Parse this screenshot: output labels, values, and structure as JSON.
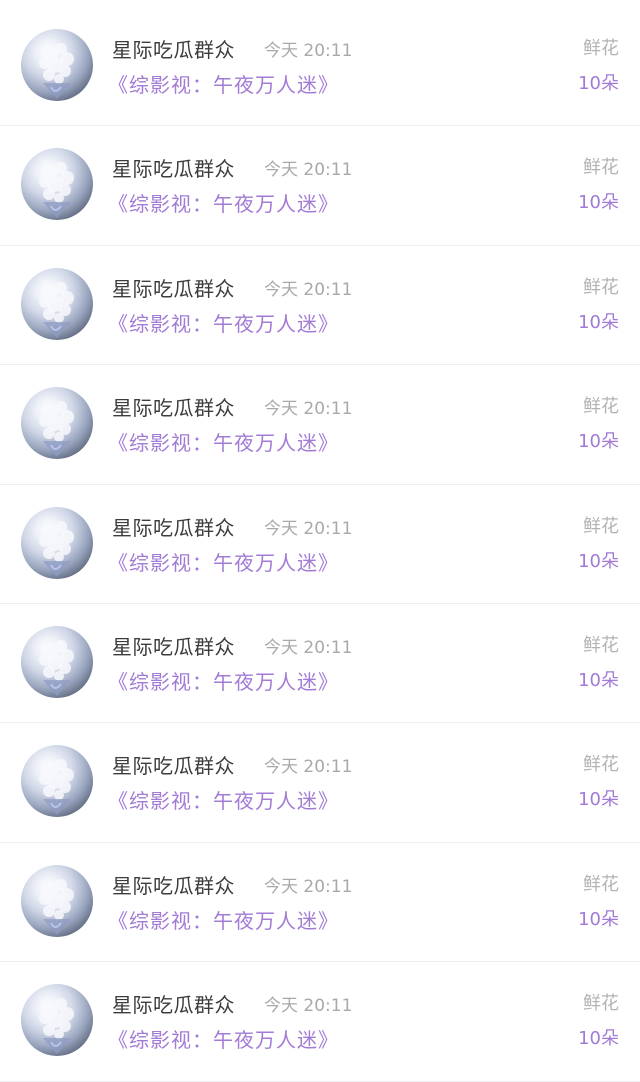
{
  "gift_list": {
    "items": [
      {
        "user": "星际吃瓜群众",
        "time": "今天 20:11",
        "book": "《综影视：午夜万人迷》",
        "gift": "鲜花",
        "count": "10朵",
        "avatar_icon": "flower-bouquet-avatar-icon"
      },
      {
        "user": "星际吃瓜群众",
        "time": "今天 20:11",
        "book": "《综影视：午夜万人迷》",
        "gift": "鲜花",
        "count": "10朵",
        "avatar_icon": "flower-bouquet-avatar-icon"
      },
      {
        "user": "星际吃瓜群众",
        "time": "今天 20:11",
        "book": "《综影视：午夜万人迷》",
        "gift": "鲜花",
        "count": "10朵",
        "avatar_icon": "flower-bouquet-avatar-icon"
      },
      {
        "user": "星际吃瓜群众",
        "time": "今天 20:11",
        "book": "《综影视：午夜万人迷》",
        "gift": "鲜花",
        "count": "10朵",
        "avatar_icon": "flower-bouquet-avatar-icon"
      },
      {
        "user": "星际吃瓜群众",
        "time": "今天 20:11",
        "book": "《综影视：午夜万人迷》",
        "gift": "鲜花",
        "count": "10朵",
        "avatar_icon": "flower-bouquet-avatar-icon"
      },
      {
        "user": "星际吃瓜群众",
        "time": "今天 20:11",
        "book": "《综影视：午夜万人迷》",
        "gift": "鲜花",
        "count": "10朵",
        "avatar_icon": "flower-bouquet-avatar-icon"
      },
      {
        "user": "星际吃瓜群众",
        "time": "今天 20:11",
        "book": "《综影视：午夜万人迷》",
        "gift": "鲜花",
        "count": "10朵",
        "avatar_icon": "flower-bouquet-avatar-icon"
      },
      {
        "user": "星际吃瓜群众",
        "time": "今天 20:11",
        "book": "《综影视：午夜万人迷》",
        "gift": "鲜花",
        "count": "10朵",
        "avatar_icon": "flower-bouquet-avatar-icon"
      },
      {
        "user": "星际吃瓜群众",
        "time": "今天 20:11",
        "book": "《综影视：午夜万人迷》",
        "gift": "鲜花",
        "count": "10朵",
        "avatar_icon": "flower-bouquet-avatar-icon"
      }
    ]
  },
  "colors": {
    "accent_purple": "#a27bd6",
    "name_text": "#3c3c3c",
    "muted_text": "#a9a9a9",
    "divider": "#efeff1"
  }
}
